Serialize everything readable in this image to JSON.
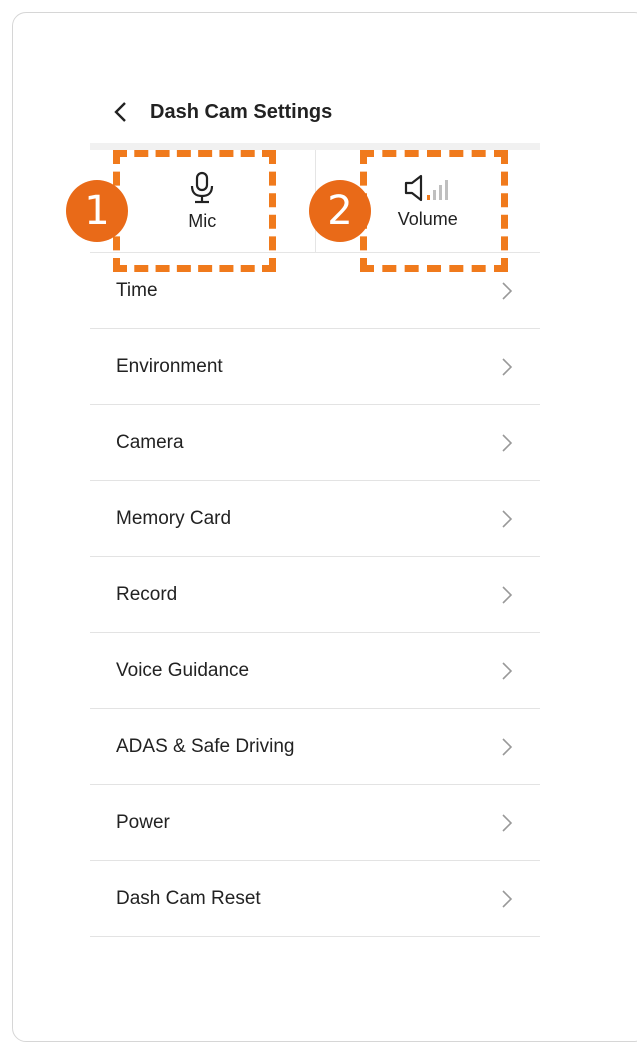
{
  "header": {
    "title": "Dash Cam Settings",
    "back_icon": "chevron-left-icon"
  },
  "quick": [
    {
      "label": "Mic",
      "icon": "microphone-icon"
    },
    {
      "label": "Volume",
      "icon": "speaker-volume-icon"
    }
  ],
  "annotations": {
    "badge1": "1",
    "badge2": "2",
    "color": "#e96a18",
    "dash_color": "#f07a1c"
  },
  "menu": [
    {
      "label": "Time"
    },
    {
      "label": "Environment"
    },
    {
      "label": "Camera"
    },
    {
      "label": "Memory Card"
    },
    {
      "label": "Record"
    },
    {
      "label": "Voice Guidance"
    },
    {
      "label": "ADAS & Safe Driving"
    },
    {
      "label": "Power"
    },
    {
      "label": "Dash Cam Reset"
    }
  ]
}
